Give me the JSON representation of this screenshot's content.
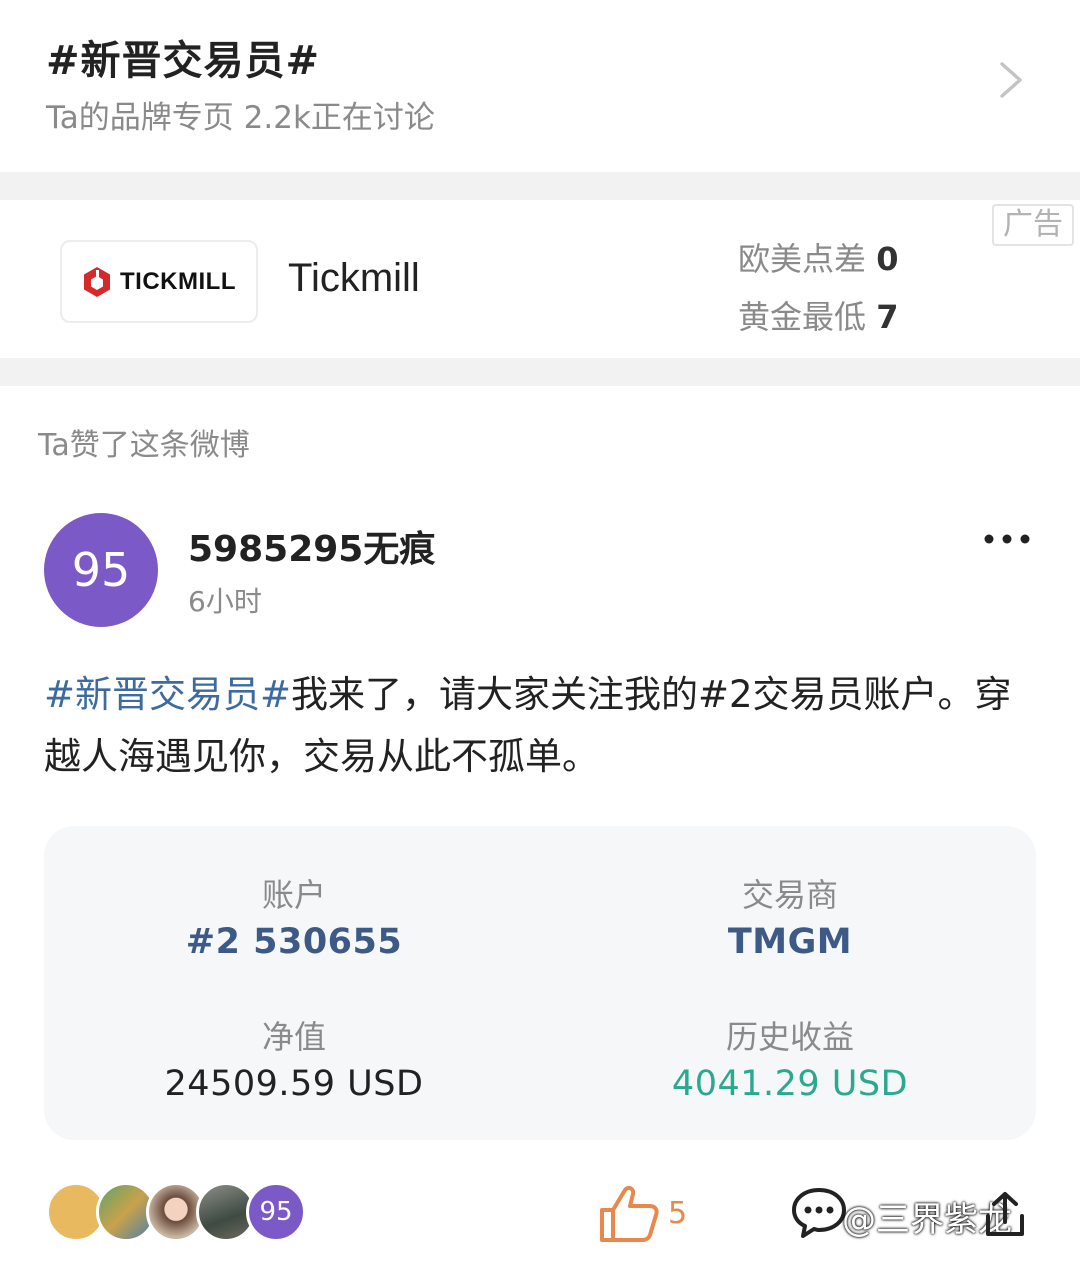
{
  "topic": {
    "title": "#新晋交易员#",
    "subtitle": "Ta的品牌专页  2.2k正在讨论"
  },
  "ad": {
    "logo_text": "TICKMILL",
    "brand_name": "Tickmill",
    "stat1_label": "欧美点差",
    "stat1_value": "0",
    "stat2_label": "黄金最低",
    "stat2_value": "7",
    "tag": "广告"
  },
  "feed_note": "Ta赞了这条微博",
  "post": {
    "avatar_text": "95",
    "username": "5985295无痕",
    "time": "6小时",
    "hashtag": "#新晋交易员#",
    "text": "我来了，请大家关注我的#2交易员账户。穿越人海遇见你，交易从此不孤单。"
  },
  "account": {
    "account_label": "账户",
    "account_value": "#2 530655",
    "broker_label": "交易商",
    "broker_value": "TMGM",
    "equity_label": "净值",
    "equity_value": "24509.59 USD",
    "profit_label": "历史收益",
    "profit_value": "4041.29 USD"
  },
  "footer": {
    "liker_last_text": "95",
    "like_count": "5",
    "watermark": "@三界紫龙"
  },
  "colors": {
    "hashtag": "#3d6ba0",
    "avatar_purple": "#7b59c6",
    "profit_teal": "#2aa98e",
    "like_orange": "#e8884a",
    "brand_red": "#d62a2a"
  }
}
